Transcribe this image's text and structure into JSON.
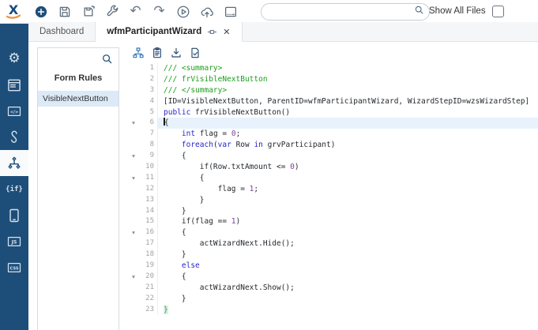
{
  "colors": {
    "accent": "#1d4e79",
    "orange": "#f0953f",
    "kw": "#2525cd",
    "cm": "#1ca01c",
    "num": "#7b3fa0",
    "match": "#27a35c",
    "hl": "#e7f2fd",
    "sel": "#dce9f7"
  },
  "toolbar": {
    "buttons": [
      {
        "name": "add-button",
        "icon": "add"
      },
      {
        "name": "save-button",
        "icon": "save"
      },
      {
        "name": "save-history-button",
        "icon": "save-history"
      },
      {
        "name": "build-button",
        "icon": "wrench"
      },
      {
        "name": "undo-button",
        "icon": "undo"
      },
      {
        "name": "redo-button",
        "icon": "redo"
      },
      {
        "name": "run-button",
        "icon": "play-circle"
      },
      {
        "name": "publish-button",
        "icon": "cloud-upload"
      },
      {
        "name": "console-button",
        "icon": "console"
      }
    ],
    "search": {
      "value": "",
      "placeholder": ""
    },
    "show_all_files_label": "Show All Files",
    "show_all_files_checked": false
  },
  "tabs": [
    {
      "label": "Dashboard",
      "active": false
    },
    {
      "label": "wfmParticipantWizard",
      "active": true
    }
  ],
  "sidebar": {
    "active_index": 4,
    "items": [
      {
        "name": "sidebar-item-settings",
        "icon": "gears",
        "label": ""
      },
      {
        "name": "sidebar-item-forms",
        "icon": "form-layout",
        "label": ""
      },
      {
        "name": "sidebar-item-code",
        "icon": "boxed",
        "label": "</>"
      },
      {
        "name": "sidebar-item-hooks",
        "icon": "hook",
        "label": ""
      },
      {
        "name": "sidebar-item-workflow",
        "icon": "workflow",
        "label": ""
      },
      {
        "name": "sidebar-item-conditions",
        "icon": "plain",
        "label": "{if}"
      },
      {
        "name": "sidebar-item-device",
        "icon": "device",
        "label": ""
      },
      {
        "name": "sidebar-item-js",
        "icon": "boxed",
        "label": "JS"
      },
      {
        "name": "sidebar-item-css",
        "icon": "boxed",
        "label": "CSS"
      }
    ]
  },
  "rules_panel": {
    "title": "Form Rules",
    "items": [
      "VisibleNextButton"
    ],
    "selected_index": 0
  },
  "editor": {
    "toolbar": [
      {
        "name": "structure-button",
        "icon": "hierarchy",
        "blue": true
      },
      {
        "name": "clipboard-button",
        "icon": "clipboard",
        "blue": false
      },
      {
        "name": "download-button",
        "icon": "download",
        "blue": false
      },
      {
        "name": "validate-button",
        "icon": "doc-check",
        "blue": false
      }
    ],
    "current_line": 6,
    "lines": [
      {
        "n": 1,
        "fold": false,
        "tokens": [
          [
            "c",
            "/// <summary>"
          ]
        ]
      },
      {
        "n": 2,
        "fold": false,
        "tokens": [
          [
            "c",
            "/// frVisibleNextButton"
          ]
        ]
      },
      {
        "n": 3,
        "fold": false,
        "tokens": [
          [
            "c",
            "/// </summary>"
          ]
        ]
      },
      {
        "n": 4,
        "fold": false,
        "tokens": [
          [
            "p",
            "[ID=VisibleNextButton, ParentID=wfmParticipantWizard, WizardStepID=wzsWizardStep]"
          ]
        ]
      },
      {
        "n": 5,
        "fold": false,
        "tokens": [
          [
            "k",
            "public"
          ],
          [
            "p",
            " frVisibleNextButton()"
          ]
        ]
      },
      {
        "n": 6,
        "fold": true,
        "cursor": true,
        "tokens": [
          [
            "p",
            "{"
          ]
        ]
      },
      {
        "n": 7,
        "fold": false,
        "tokens": [
          [
            "p",
            "    "
          ],
          [
            "k",
            "int"
          ],
          [
            "p",
            " flag = "
          ],
          [
            "n",
            "0"
          ],
          [
            "p",
            ";"
          ]
        ]
      },
      {
        "n": 8,
        "fold": false,
        "tokens": [
          [
            "p",
            "    "
          ],
          [
            "k",
            "foreach"
          ],
          [
            "p",
            "("
          ],
          [
            "k",
            "var"
          ],
          [
            "p",
            " Row "
          ],
          [
            "k",
            "in"
          ],
          [
            "p",
            " grvParticipant)"
          ]
        ]
      },
      {
        "n": 9,
        "fold": true,
        "tokens": [
          [
            "p",
            "    {"
          ]
        ]
      },
      {
        "n": 10,
        "fold": false,
        "tokens": [
          [
            "p",
            "        if(Row.txtAmount <= "
          ],
          [
            "n",
            "0"
          ],
          [
            "p",
            ")"
          ]
        ]
      },
      {
        "n": 11,
        "fold": true,
        "tokens": [
          [
            "p",
            "        {"
          ]
        ]
      },
      {
        "n": 12,
        "fold": false,
        "tokens": [
          [
            "p",
            "            flag = "
          ],
          [
            "n",
            "1"
          ],
          [
            "p",
            ";"
          ]
        ]
      },
      {
        "n": 13,
        "fold": false,
        "tokens": [
          [
            "p",
            "        }"
          ]
        ]
      },
      {
        "n": 14,
        "fold": false,
        "tokens": [
          [
            "p",
            "    }"
          ]
        ]
      },
      {
        "n": 15,
        "fold": false,
        "tokens": [
          [
            "p",
            "    if(flag == "
          ],
          [
            "n",
            "1"
          ],
          [
            "p",
            ")"
          ]
        ]
      },
      {
        "n": 16,
        "fold": true,
        "tokens": [
          [
            "p",
            "    {"
          ]
        ]
      },
      {
        "n": 17,
        "fold": false,
        "tokens": [
          [
            "p",
            "        actWizardNext.Hide();"
          ]
        ]
      },
      {
        "n": 18,
        "fold": false,
        "tokens": [
          [
            "p",
            "    }"
          ]
        ]
      },
      {
        "n": 19,
        "fold": false,
        "tokens": [
          [
            "p",
            "    "
          ],
          [
            "k",
            "else"
          ]
        ]
      },
      {
        "n": 20,
        "fold": true,
        "tokens": [
          [
            "p",
            "    {"
          ]
        ]
      },
      {
        "n": 21,
        "fold": false,
        "tokens": [
          [
            "p",
            "        actWizardNext.Show();"
          ]
        ]
      },
      {
        "n": 22,
        "fold": false,
        "tokens": [
          [
            "p",
            "    }"
          ]
        ]
      },
      {
        "n": 23,
        "fold": false,
        "tokens": [
          [
            "m",
            "}"
          ]
        ]
      }
    ]
  }
}
